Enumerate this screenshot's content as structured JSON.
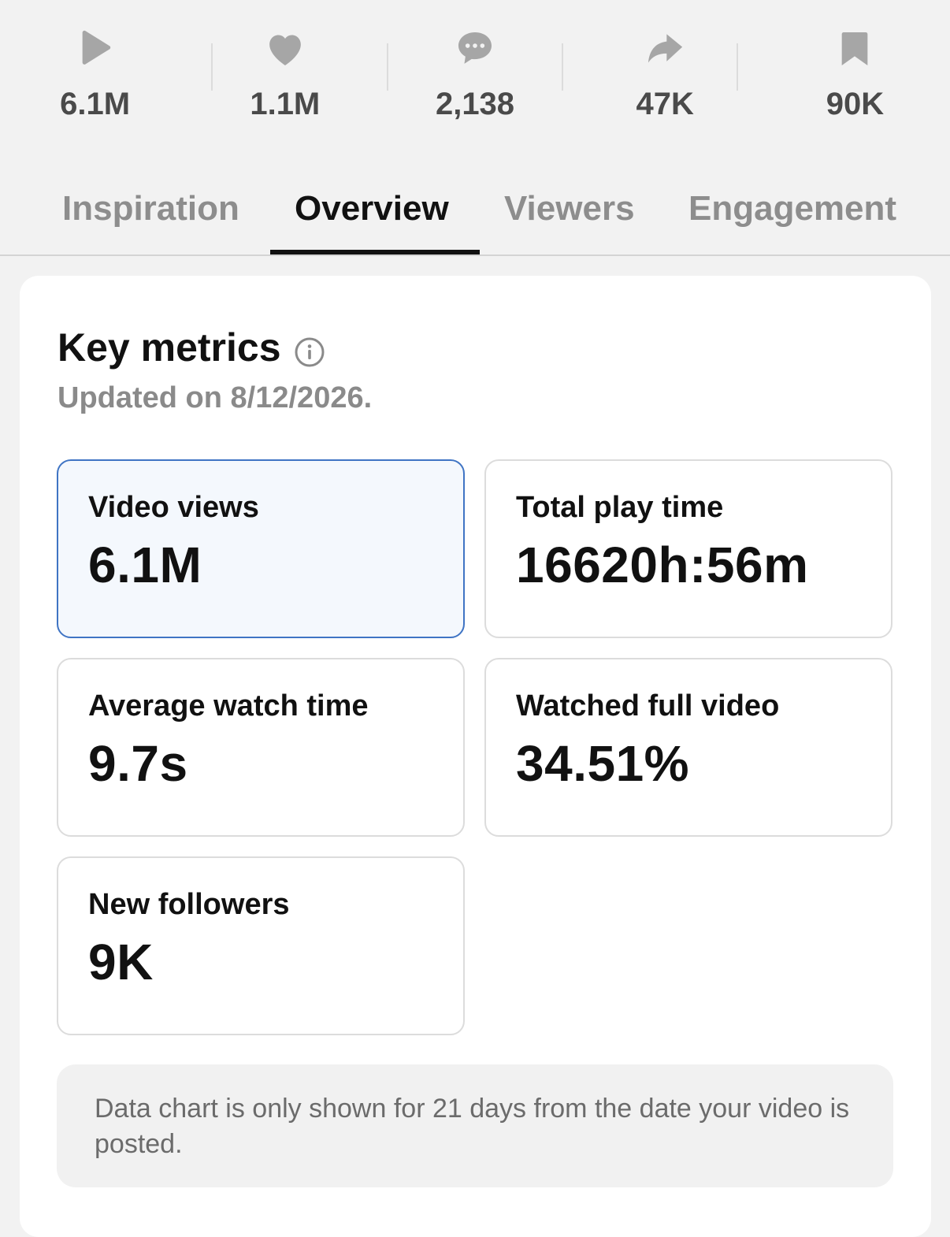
{
  "stats": [
    {
      "icon": "play-icon",
      "value": "6.1M"
    },
    {
      "icon": "heart-icon",
      "value": "1.1M"
    },
    {
      "icon": "comment-icon",
      "value": "2,138"
    },
    {
      "icon": "share-icon",
      "value": "47K"
    },
    {
      "icon": "bookmark-icon",
      "value": "90K"
    }
  ],
  "tabs": [
    "Inspiration",
    "Overview",
    "Viewers",
    "Engagement"
  ],
  "active_tab": "Overview",
  "key_metrics": {
    "title": "Key metrics",
    "updated": "Updated on 8/12/2026.",
    "cards": [
      {
        "label": "Video views",
        "value": "6.1M",
        "selected": true
      },
      {
        "label": "Total play time",
        "value": "16620h:56m",
        "selected": false
      },
      {
        "label": "Average watch time",
        "value": "9.7s",
        "selected": false
      },
      {
        "label": "Watched full video",
        "value": "34.51%",
        "selected": false
      },
      {
        "label": "New followers",
        "value": "9K",
        "selected": false
      }
    ],
    "note": "Data chart is only shown for 21 days from the date your video is posted."
  },
  "colors": {
    "accent_border": "#3f74c4",
    "selected_bg": "#f4f8fd",
    "icon_gray": "#a6a6a6"
  }
}
